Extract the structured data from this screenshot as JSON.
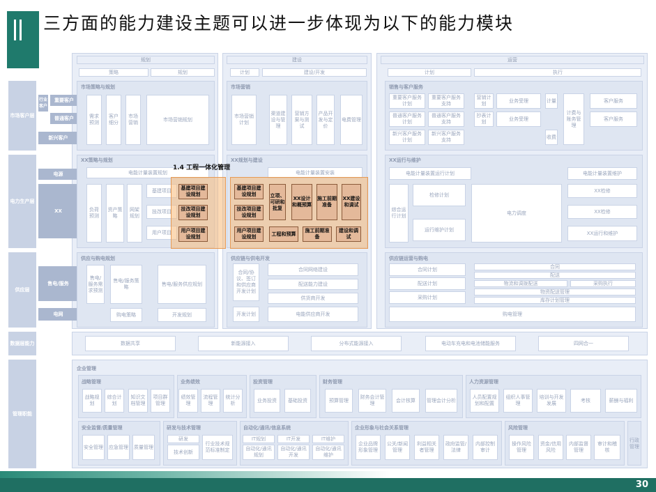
{
  "title": "三方面的能力建设主题可以进一步体现为以下的能力模块",
  "page_number": "30",
  "column_headers": [
    "规划",
    "建设",
    "运营"
  ],
  "sub_headers": {
    "plan": [
      "策略",
      "规划"
    ],
    "build": [
      "计划",
      "建设/开发"
    ],
    "ops": [
      "计划",
      "执行"
    ]
  },
  "left_labels": {
    "market": "市场客户层",
    "power": "电力生产层",
    "supply": "供应层",
    "data": "数据层能力",
    "mgmt": "管理职能"
  },
  "left_sub": [
    "行业客户",
    "重要客户",
    "普通客户",
    "新兴客户",
    "电源",
    "XX",
    "售电/服务",
    "电网"
  ],
  "sections": {
    "mkt_plan": "市场策略与规划",
    "mkt_build": "市场营销",
    "mkt_ops": "销售与客户服务",
    "xx_plan": "XX策略与规划",
    "xx_build": "XX规划与建设",
    "xx_ops": "XX运行与维护",
    "sup_plan": "供应与购电规划",
    "sup_build": "供应链与供电开发",
    "sup_ops": "供应链运营与购电",
    "mgmt": "企业管理",
    "hr": "人力资源管理"
  },
  "market_plan_cells": [
    "需求预测",
    "客户细分",
    "市场营销",
    "市场营销规划"
  ],
  "market_build_cells": [
    "市场营销计划",
    "渠道建设与管理",
    "营销方案与测试",
    "产品开发与定价",
    "电费管理"
  ],
  "market_ops_cells": [
    "重要客户服务计划",
    "重要客户服务支持",
    "营销计划",
    "业务受理",
    "计量",
    "普通客户服务计划",
    "普通客户服务支持",
    "抄表计划",
    "业务受理",
    "计费与账务管理",
    "客户服务",
    "新兴客户服务计划",
    "新兴客户服务支持",
    "客户服务",
    "收费"
  ],
  "xx_plan_cells": [
    "电能计量装置规划",
    "负荷预测",
    "资产策略",
    "网架规划",
    "基建项目",
    "技改项目",
    "用户项目"
  ],
  "xx_build_cells": [
    "电能计量装置安装"
  ],
  "xx_ops_cells": [
    "电能计量装置运行计划",
    "电能计量装置维护",
    "XX检修",
    "XX检修",
    "综合运行计划",
    "检修计划",
    "运行维护计划",
    "电力调度",
    "XX运行和维护"
  ],
  "highlight": {
    "title": "1.4 工程一体化管理",
    "plan": [
      "基建项目建设规划",
      "技改项目建设规划",
      "用户项目建设规划"
    ],
    "build": [
      "基建项目建设规划",
      "技改项目建设规划",
      "用户项目建设规划",
      "立项、可研和批复",
      "XX设计和概预算",
      "施工前期准备",
      "XX建设和调试",
      "工程和预算",
      "施工前期准备",
      "建设和调试"
    ]
  },
  "supply_plan_cells": [
    "售电/服务需求预测",
    "售电/服务策略",
    "售电/服务供应规划",
    "购电策略",
    "开发规划"
  ],
  "supply_build_cells": [
    "合同/协议、签订和供应商开发计划",
    "合同网络建设",
    "配送能力建设",
    "供货商开发",
    "开发计划",
    "电能供应商开发"
  ],
  "supply_ops_cells": [
    "合同计划",
    "合同",
    "配送计划",
    "配送",
    "物流和调拨配送",
    "采购执行",
    "物资配送管理",
    "库存计划管理",
    "采购计划",
    "购电管理"
  ],
  "data_cells": [
    "数据共享",
    "新能源接入",
    "分布式能源接入",
    "电动车充电和电池储能服务",
    "四网合一"
  ],
  "mgmt_groups": [
    {
      "title": "战略管理",
      "cells": [
        "战略规划",
        "综合计划",
        "知识文档管理",
        "项目群管理"
      ]
    },
    {
      "title": "业务绩效",
      "cells": [
        "绩效管理",
        "流程管理",
        "统计分析"
      ]
    },
    {
      "title": "投资管理",
      "cells": [
        "业务投资",
        "基础投资"
      ]
    },
    {
      "title": "财务管理",
      "cells": [
        "预算管理",
        "财务会计管理",
        "会计核算",
        "管理会计分析"
      ]
    },
    {
      "title": "人力资源管理",
      "cells": [
        "人员配置规划和配置",
        "组织人事管理",
        "培训与开发发展",
        "考核",
        "薪酬与福利"
      ]
    },
    {
      "title": "安全监督/质量管理",
      "cells": [
        "安全管理",
        "应急管理",
        "质量管理"
      ]
    },
    {
      "title": "研发与技术管理",
      "cells": [
        "研发",
        "技术创新",
        "行业技术规范标准制定"
      ]
    },
    {
      "title": "自动化/通讯/信息系统",
      "cells": [
        "IT规划",
        "IT开发",
        "IT维护",
        "自动化/通讯规划",
        "自动化/通讯开发",
        "自动化/通讯维护"
      ]
    },
    {
      "title": "企业形象与社会关系管理",
      "cells": [
        "企业品牌形象管理",
        "公关/新闻管理",
        "利益相关者管理",
        "政府监管/法律",
        "内部控制审计"
      ]
    },
    {
      "title": "风险管理",
      "cells": [
        "操作风险管理",
        "资金/信用风险",
        "内部监督管理",
        "审计和稽核"
      ]
    },
    {
      "title": "",
      "cells": [
        "行政管理"
      ]
    }
  ]
}
